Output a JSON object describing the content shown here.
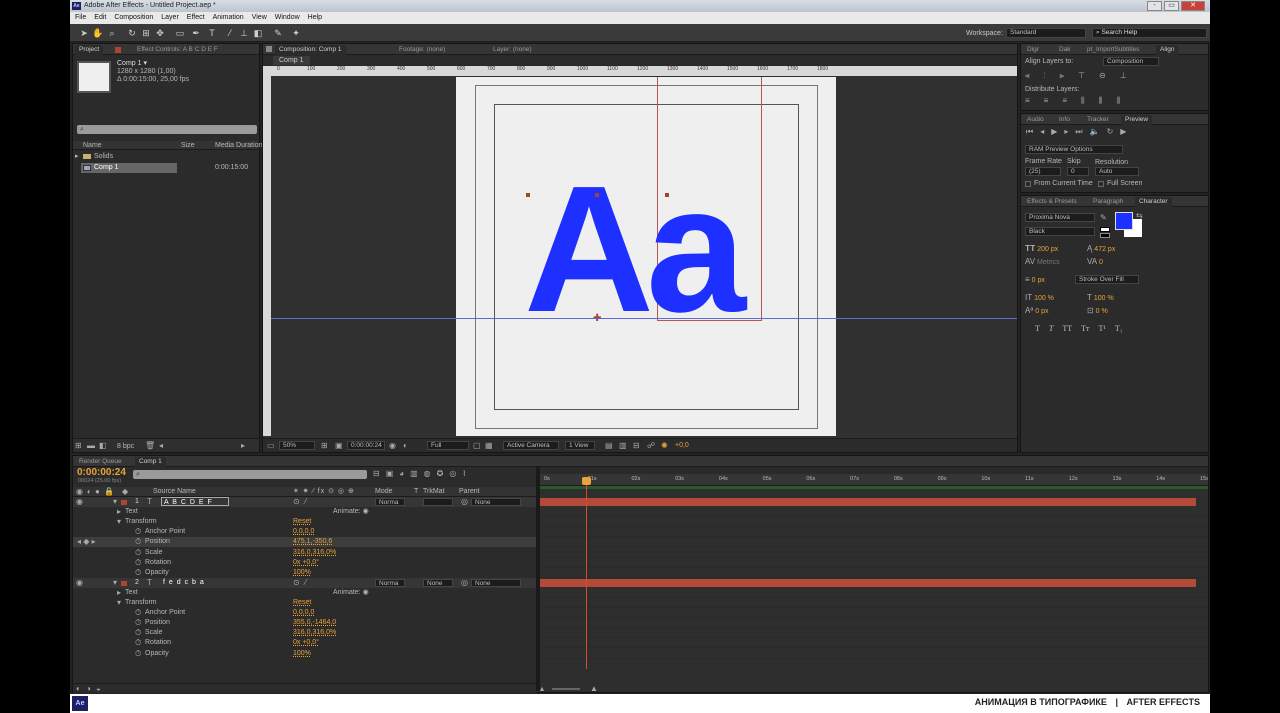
{
  "app": {
    "title": "Adobe After Effects - Untitled Project.aep *",
    "icon": "Ae"
  },
  "window_buttons": [
    "-",
    "▭",
    "✕"
  ],
  "menu": [
    "File",
    "Edit",
    "Composition",
    "Layer",
    "Effect",
    "Animation",
    "View",
    "Window",
    "Help"
  ],
  "toolbar": {
    "workspace_label": "Workspace:",
    "workspace_value": "Standard",
    "search_placeholder": "Search Help"
  },
  "project_panel": {
    "tabs": [
      "Project",
      "Effect Controls: A B C D E F"
    ],
    "comp_name": "Comp 1 ▾",
    "comp_dims": "1280 x 1280 (1,00)",
    "comp_duration": "Δ 0:00:15:00, 25,00 fps",
    "columns": [
      "Name",
      "Size",
      "Media Duration"
    ],
    "items": [
      {
        "name": "Solids",
        "size": "",
        "duration": ""
      },
      {
        "name": "Comp 1",
        "size": "",
        "duration": "0:00:15:00"
      }
    ],
    "bpc": "8 bpc"
  },
  "viewer": {
    "tabs": [
      "Composition: Comp 1",
      "Footage: (none)",
      "Layer: (none)"
    ],
    "subtab": "Comp 1",
    "ruler_labels": [
      "0",
      "100",
      "200",
      "300",
      "400",
      "500",
      "600",
      "700",
      "800",
      "900",
      "1000",
      "1100",
      "1200",
      "1300",
      "1400",
      "1500",
      "1600",
      "1700",
      "1800"
    ],
    "artwork_text": "Aa",
    "footer": {
      "zoom": "50%",
      "timecode": "0:00:00:24",
      "resolution": "Full",
      "camera": "Active Camera",
      "views": "1 View",
      "exposure": "+0,0"
    }
  },
  "align_panel": {
    "tabs": [
      "Digr",
      "Dak",
      "pt_ImportSubtitles",
      "Align"
    ],
    "align_to_label": "Align Layers to:",
    "align_to_value": "Composition",
    "distribute_label": "Distribute Layers:"
  },
  "preview_panel": {
    "tabs": [
      "Audio",
      "Info",
      "Tracker",
      "Preview"
    ],
    "ram_options": "RAM Preview Options",
    "frame_rate_label": "Frame Rate",
    "frame_rate": "(25)",
    "skip_label": "Skip",
    "skip": "0",
    "resolution_label": "Resolution",
    "resolution": "Auto",
    "from_current": "From Current Time",
    "full_screen": "Full Screen"
  },
  "character_panel": {
    "tabs": [
      "Effects & Presets",
      "Paragraph",
      "Character"
    ],
    "font": "Proxima Nova",
    "style": "Black",
    "size": "200 px",
    "leading": "472 px",
    "kerning": "Metrics",
    "tracking": "0",
    "stroke": "0 px",
    "stroke_type": "Stroke Over Fill",
    "vscale": "100 %",
    "hscale": "100 %",
    "baseline": "0 px",
    "tsume": "0 %",
    "fill_color": "#1e30ff",
    "styles": [
      "T",
      "T",
      "TT",
      "Tт",
      "T¹",
      "T₁"
    ]
  },
  "timeline": {
    "tabs": [
      "Render Queue",
      "Comp 1"
    ],
    "timecode": "0:00:00:24",
    "frames": "00024 (25.00 fps)",
    "columns": [
      "Source Name",
      "Mode",
      "T",
      "TrkMat",
      "Parent"
    ],
    "ruler": [
      "0s",
      "01s",
      "02s",
      "03s",
      "04s",
      "05s",
      "06s",
      "07s",
      "08s",
      "09s",
      "10s",
      "11s",
      "12s",
      "13s",
      "14s",
      "15s"
    ],
    "playhead_seconds": 0.96,
    "duration_seconds": 15,
    "layers": [
      {
        "num": "1",
        "name": "A B C D E F",
        "mode": "Norma",
        "trkmat": "",
        "parent": "None",
        "props": [
          {
            "label": "Text",
            "value": "",
            "animate": "Animate:"
          },
          {
            "label": "Transform",
            "value": "Reset"
          },
          {
            "label": "Anchor Point",
            "value": "0,0,0,0"
          },
          {
            "label": "Position",
            "value": "475,1,-350,6"
          },
          {
            "label": "Scale",
            "value": "316,0,316,0%"
          },
          {
            "label": "Rotation",
            "value": "0x +0,0°"
          },
          {
            "label": "Opacity",
            "value": "100%"
          }
        ]
      },
      {
        "num": "2",
        "name": "f e d c b a",
        "mode": "Norma",
        "trkmat": "None",
        "parent": "None",
        "props": [
          {
            "label": "Text",
            "value": "",
            "animate": "Animate:"
          },
          {
            "label": "Transform",
            "value": "Reset"
          },
          {
            "label": "Anchor Point",
            "value": "0,0,0,0"
          },
          {
            "label": "Position",
            "value": "355,0,-1464,0"
          },
          {
            "label": "Scale",
            "value": "316,0,316,0%"
          },
          {
            "label": "Rotation",
            "value": "0x +0,0°"
          },
          {
            "label": "Opacity",
            "value": "100%"
          }
        ]
      }
    ]
  },
  "caption": {
    "left": "АНИМАЦИЯ В ТИПОГРАФИКЕ",
    "sep": "|",
    "right": "AFTER EFFECTS",
    "badge": "Ae"
  },
  "colors": {
    "accent_orange": "#e8a33a",
    "type_blue": "#1e30ff",
    "layer_bar": "#b44a3a"
  }
}
